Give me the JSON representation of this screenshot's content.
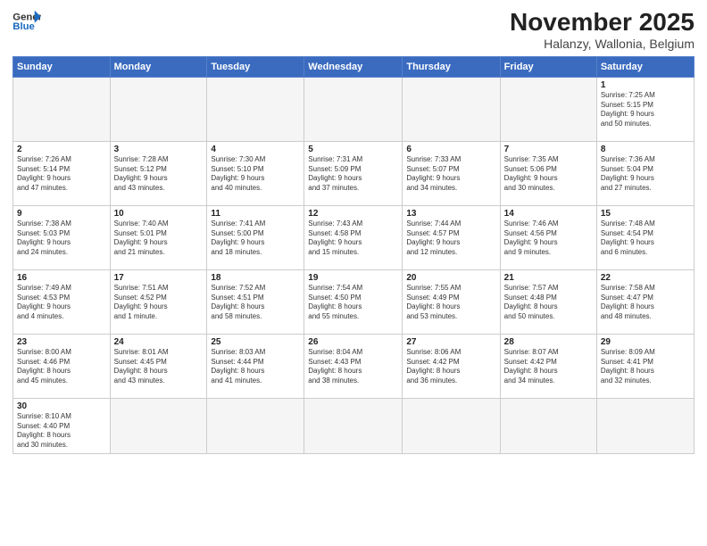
{
  "header": {
    "logo_general": "General",
    "logo_blue": "Blue",
    "title": "November 2025",
    "subtitle": "Halanzy, Wallonia, Belgium"
  },
  "days_of_week": [
    "Sunday",
    "Monday",
    "Tuesday",
    "Wednesday",
    "Thursday",
    "Friday",
    "Saturday"
  ],
  "weeks": [
    [
      {
        "day": "",
        "info": ""
      },
      {
        "day": "",
        "info": ""
      },
      {
        "day": "",
        "info": ""
      },
      {
        "day": "",
        "info": ""
      },
      {
        "day": "",
        "info": ""
      },
      {
        "day": "",
        "info": ""
      },
      {
        "day": "1",
        "info": "Sunrise: 7:25 AM\nSunset: 5:15 PM\nDaylight: 9 hours\nand 50 minutes."
      }
    ],
    [
      {
        "day": "2",
        "info": "Sunrise: 7:26 AM\nSunset: 5:14 PM\nDaylight: 9 hours\nand 47 minutes."
      },
      {
        "day": "3",
        "info": "Sunrise: 7:28 AM\nSunset: 5:12 PM\nDaylight: 9 hours\nand 43 minutes."
      },
      {
        "day": "4",
        "info": "Sunrise: 7:30 AM\nSunset: 5:10 PM\nDaylight: 9 hours\nand 40 minutes."
      },
      {
        "day": "5",
        "info": "Sunrise: 7:31 AM\nSunset: 5:09 PM\nDaylight: 9 hours\nand 37 minutes."
      },
      {
        "day": "6",
        "info": "Sunrise: 7:33 AM\nSunset: 5:07 PM\nDaylight: 9 hours\nand 34 minutes."
      },
      {
        "day": "7",
        "info": "Sunrise: 7:35 AM\nSunset: 5:06 PM\nDaylight: 9 hours\nand 30 minutes."
      },
      {
        "day": "8",
        "info": "Sunrise: 7:36 AM\nSunset: 5:04 PM\nDaylight: 9 hours\nand 27 minutes."
      }
    ],
    [
      {
        "day": "9",
        "info": "Sunrise: 7:38 AM\nSunset: 5:03 PM\nDaylight: 9 hours\nand 24 minutes."
      },
      {
        "day": "10",
        "info": "Sunrise: 7:40 AM\nSunset: 5:01 PM\nDaylight: 9 hours\nand 21 minutes."
      },
      {
        "day": "11",
        "info": "Sunrise: 7:41 AM\nSunset: 5:00 PM\nDaylight: 9 hours\nand 18 minutes."
      },
      {
        "day": "12",
        "info": "Sunrise: 7:43 AM\nSunset: 4:58 PM\nDaylight: 9 hours\nand 15 minutes."
      },
      {
        "day": "13",
        "info": "Sunrise: 7:44 AM\nSunset: 4:57 PM\nDaylight: 9 hours\nand 12 minutes."
      },
      {
        "day": "14",
        "info": "Sunrise: 7:46 AM\nSunset: 4:56 PM\nDaylight: 9 hours\nand 9 minutes."
      },
      {
        "day": "15",
        "info": "Sunrise: 7:48 AM\nSunset: 4:54 PM\nDaylight: 9 hours\nand 6 minutes."
      }
    ],
    [
      {
        "day": "16",
        "info": "Sunrise: 7:49 AM\nSunset: 4:53 PM\nDaylight: 9 hours\nand 4 minutes."
      },
      {
        "day": "17",
        "info": "Sunrise: 7:51 AM\nSunset: 4:52 PM\nDaylight: 9 hours\nand 1 minute."
      },
      {
        "day": "18",
        "info": "Sunrise: 7:52 AM\nSunset: 4:51 PM\nDaylight: 8 hours\nand 58 minutes."
      },
      {
        "day": "19",
        "info": "Sunrise: 7:54 AM\nSunset: 4:50 PM\nDaylight: 8 hours\nand 55 minutes."
      },
      {
        "day": "20",
        "info": "Sunrise: 7:55 AM\nSunset: 4:49 PM\nDaylight: 8 hours\nand 53 minutes."
      },
      {
        "day": "21",
        "info": "Sunrise: 7:57 AM\nSunset: 4:48 PM\nDaylight: 8 hours\nand 50 minutes."
      },
      {
        "day": "22",
        "info": "Sunrise: 7:58 AM\nSunset: 4:47 PM\nDaylight: 8 hours\nand 48 minutes."
      }
    ],
    [
      {
        "day": "23",
        "info": "Sunrise: 8:00 AM\nSunset: 4:46 PM\nDaylight: 8 hours\nand 45 minutes."
      },
      {
        "day": "24",
        "info": "Sunrise: 8:01 AM\nSunset: 4:45 PM\nDaylight: 8 hours\nand 43 minutes."
      },
      {
        "day": "25",
        "info": "Sunrise: 8:03 AM\nSunset: 4:44 PM\nDaylight: 8 hours\nand 41 minutes."
      },
      {
        "day": "26",
        "info": "Sunrise: 8:04 AM\nSunset: 4:43 PM\nDaylight: 8 hours\nand 38 minutes."
      },
      {
        "day": "27",
        "info": "Sunrise: 8:06 AM\nSunset: 4:42 PM\nDaylight: 8 hours\nand 36 minutes."
      },
      {
        "day": "28",
        "info": "Sunrise: 8:07 AM\nSunset: 4:42 PM\nDaylight: 8 hours\nand 34 minutes."
      },
      {
        "day": "29",
        "info": "Sunrise: 8:09 AM\nSunset: 4:41 PM\nDaylight: 8 hours\nand 32 minutes."
      }
    ],
    [
      {
        "day": "30",
        "info": "Sunrise: 8:10 AM\nSunset: 4:40 PM\nDaylight: 8 hours\nand 30 minutes."
      },
      {
        "day": "",
        "info": ""
      },
      {
        "day": "",
        "info": ""
      },
      {
        "day": "",
        "info": ""
      },
      {
        "day": "",
        "info": ""
      },
      {
        "day": "",
        "info": ""
      },
      {
        "day": "",
        "info": ""
      }
    ]
  ]
}
